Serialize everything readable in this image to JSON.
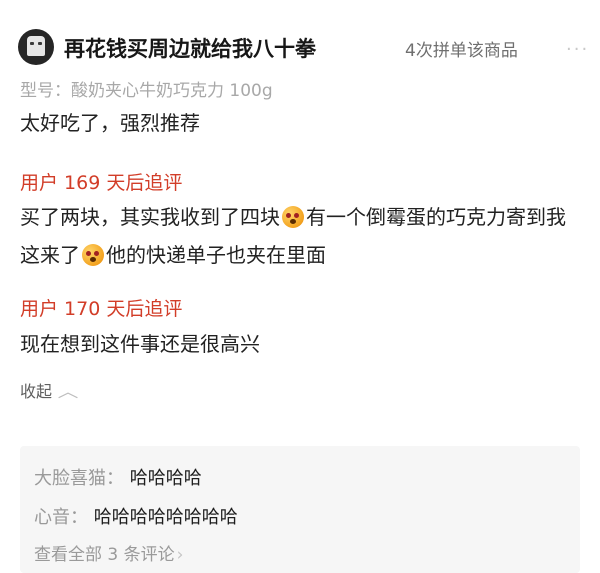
{
  "header": {
    "username": "再花钱买周边就给我八十拳",
    "purchase_count": "4次拼单该商品",
    "more_label": "···"
  },
  "spec": "型号：酸奶夹心牛奶巧克力 100g",
  "review": "太好吃了，强烈推荐",
  "follow_ups": [
    {
      "title": "用户 169 天后追评",
      "text_part1": "买了两块，其实我收到了四块",
      "text_part2": "有一个倒霉蛋的巧克力寄到我这来了",
      "text_part3": "他的快递单子也夹在里面"
    },
    {
      "title": "用户 170 天后追评",
      "text": "现在想到这件事还是很高兴"
    }
  ],
  "collapse_label": "收起",
  "comments": [
    {
      "name": "大脸喜猫：",
      "text": "哈哈哈哈"
    },
    {
      "name": "心音：",
      "text": "哈哈哈哈哈哈哈哈"
    }
  ],
  "view_all": "查看全部 3 条评论",
  "icons": {
    "emoji": "shocked-face-emoji-icon",
    "chevron_up": "chevron-up-icon",
    "chevron_right": "chevron-right-icon"
  }
}
